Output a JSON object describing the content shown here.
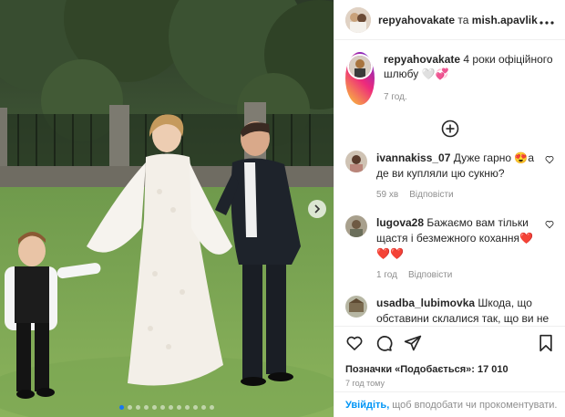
{
  "post": {
    "author": "repyahovakate",
    "connector": "та",
    "collaborator": "mish.apavlik",
    "caption_text": "4 роки офіційного шлюбу 🤍💞",
    "caption_time": "7 год.",
    "slide_count": 12,
    "active_slide": 1
  },
  "comments": [
    {
      "user": "ivannakiss_07",
      "text": "Дуже гарно 😍а де ви купляли цю сукню?",
      "time": "59 хв",
      "reply": "Відповісти"
    },
    {
      "user": "lugova28",
      "text": "Бажаємо вам тільки щастя і безмежного кохання❤️❤️❤️",
      "time": "1 год",
      "reply": "Відповісти"
    },
    {
      "user": "usadba_lubimovka",
      "text": "Шкода, що обставини склалися так, що ви не змогли відсвяткувати своє весілля у нас. Бажаємо щастя вашій родині.",
      "time": "",
      "reply": ""
    }
  ],
  "likes": {
    "label": "Позначки «Подобається»:",
    "count": "17 010"
  },
  "posted_ago": "7 год тому",
  "login_prompt": {
    "link": "Увійдіть,",
    "rest": "щоб вподобати чи прокоментувати."
  },
  "icons": [
    "more-icon",
    "add-circle-icon",
    "heart-icon",
    "comment-icon",
    "share-icon",
    "bookmark-icon",
    "chevron-right-icon"
  ],
  "colors": {
    "accent": "#0095f6",
    "dot_active": "#1877f2",
    "muted": "#8e8e8e"
  }
}
